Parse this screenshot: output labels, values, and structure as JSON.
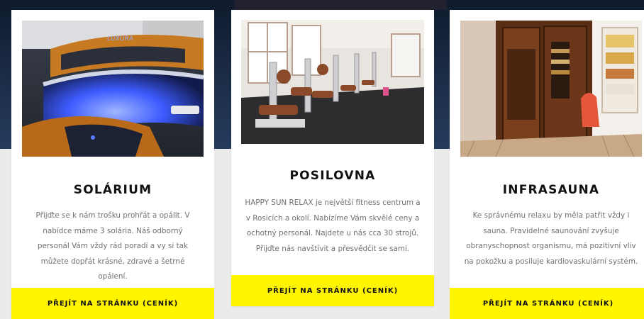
{
  "cards": [
    {
      "title": "SOLÁRIUM",
      "description": "Přijďte se k nám trošku prohřát a opálit. V nabídce máme 3 solária. Náš odborný personál Vám vždy rád poradí a vy si tak můžete dopřát krásné, zdravé a šetrné opálení.",
      "image_label": "LUXURA",
      "button_label": "PŘEJÍT NA STRÁNKU (CENÍK)"
    },
    {
      "title": "POSILOVNA",
      "description": "HAPPY SUN RELAX je největší fitness centrum a v Rosicích a okolí. Nabízíme Vám skvělé ceny a ochotný personál. Najdete u nás cca 30 strojů. Přijďte nás navštívit a přesvědčit se sami.",
      "button_label": "PŘEJÍT NA STRÁNKU (CENÍK)"
    },
    {
      "title": "INFRASAUNA",
      "description": "Ke správnému relaxu by měla patřit vždy i sauna. Pravidelné saunování zvyšuje obranyschopnost organismu, má pozitivní vliv na pokožku a posiluje kardiovaskulární systém.",
      "button_label": "PŘEJÍT NA STRÁNKU (CENÍK)"
    }
  ]
}
